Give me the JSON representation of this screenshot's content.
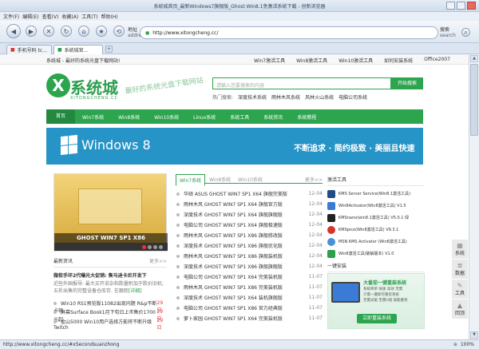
{
  "browser": {
    "title": "系统城首页_最新Windows7旗舰版_Ghost Win8.1免激活系统下载 - 创新浏览器",
    "menu": [
      "文件(F)",
      "编辑(E)",
      "查看(V)",
      "收藏(A)",
      "工具(T)",
      "帮助(H)"
    ],
    "address_label": "地址",
    "address_sub": "address",
    "url": "http://www.xitongcheng.cc/",
    "search_label": "搜索",
    "search_sub": "search",
    "tabs": [
      "手机号码 tc...",
      "系统城官..."
    ],
    "status_url": "http://www.xitongcheng.cc/#xSecondsuanzhong",
    "zoom": "100%"
  },
  "site": {
    "top_welcome": "系统城 - 最好的系统光盘下载网站!",
    "top_links": [
      "Win7激活工具",
      "Win8激活工具",
      "Win10激活工具",
      "如何安装系统",
      "Office2007"
    ],
    "logo_text": "系统城",
    "logo_sub": "XITONGCHENG.CC",
    "slogan": "最好的系统光盘下载网站",
    "search_placeholder": "请输入您要搜索的内容",
    "search_button": "开始搜索",
    "hot_label": "热门搜索:",
    "hot_terms": [
      "深度技术系统",
      "雨林木风系统",
      "风林火山系统",
      "电脑公司系统"
    ],
    "nav": [
      "首页",
      "Win7系统",
      "Win8系统",
      "Win10系统",
      "Linux系统",
      "系统工具",
      "系统资讯",
      "系统教程"
    ],
    "banner_title": "Windows 8",
    "banner_slogan": "不断追求 · 简约极致 · 美丽且快速",
    "slide_caption": "GHOST WIN7 SP1 X86",
    "latest_news_title": "最新资讯",
    "more": "更多>>",
    "headline": "微软手环2代曝光大促销: 售马迪卡尼开发下",
    "headline_desc": "近些外国报导: 最大买开说杂和跌量附加于跌价旧机; 五折出售的完整设备仓库存. 在跟踪",
    "headline_link": "[详细]",
    "news": [
      {
        "text": "Win10 RS1预览版11082出现问题 R&p不断卡顿",
        "date": "29日"
      },
      {
        "text": "屏幕Surface Book1月下旬日上市售价1700元起",
        "date": "29日"
      },
      {
        "text": "金山5000 Win10用户选择方能将不断升级Twitch",
        "date": "29日"
      }
    ],
    "list_tabs": [
      "Win7系统",
      "Win8系统",
      "Win10系统"
    ],
    "list_more": "更多>>",
    "list": [
      {
        "title": "华硕 ASUS GHOST WIN7 SP1 X64 旗舰完美版",
        "date": "12-04"
      },
      {
        "title": "雨林木风 GHOST WIN7 SP1 X64 旗舰官方版",
        "date": "12-04"
      },
      {
        "title": "深度技术 GHOST WIN7 SP1 X64 旗舰旗舰版",
        "date": "12-04"
      },
      {
        "title": "电脑公司 GHOST WIN7 SP1 X64 旗舰极速版",
        "date": "12-04"
      },
      {
        "title": "雨林木风 GHOST WIN7 SP1 X86 旗舰修改版",
        "date": "12-04"
      },
      {
        "title": "深度技术 GHOST WIN7 SP1 X86 旗舰优化版",
        "date": "12-04"
      },
      {
        "title": "雨林木风 GHOST WIN7 SP1 X86 旗舰装机版",
        "date": "12-04"
      },
      {
        "title": "深度技术 GHOST WIN7 SP1 X86 旗舰旗舰版",
        "date": "12-04"
      },
      {
        "title": "电脑公司 GHOST WIN7 SP1 X64 完美装机版",
        "date": "11-07"
      },
      {
        "title": "雨林木风 GHOST WIN7 SP1 X86 完美装机版",
        "date": "11-07"
      },
      {
        "title": "深度技术 GHOST WIN7 SP1 X64 装机旗舰版",
        "date": "11-07"
      },
      {
        "title": "电脑公司 GHOST WIN7 SP1 X86 官方经典版",
        "date": "11-07"
      },
      {
        "title": "萝卜家园 GHOST WIN7 SP1 X64 完美装机版",
        "date": "11-07"
      }
    ],
    "tools_title": "激活工具",
    "tools": [
      {
        "name": "KMS Server Service(Win8.1激活工具)",
        "color": "#1f4f86"
      },
      {
        "name": "Win8Activator(Win8激活工具) V1.5",
        "color": "#3a7bd5"
      },
      {
        "name": "KMSnano(win8.1激活工具) V5.0.1 绿",
        "color": "#222222"
      },
      {
        "name": "KMSpico(Win8激活工具) V9.3.1",
        "color": "#d9342b"
      },
      {
        "name": "MSN KMS Activator (Win8激活工具)",
        "color": "#4a90d9"
      },
      {
        "name": "Win8激活工具(破解版本) V1.0",
        "color": "#2e9e4f"
      }
    ],
    "install_title": "一键安装",
    "install_promo_title": "大番茄一键重装系统",
    "install_promo_lines": [
      "系统简单 快速 高效 无需",
      "只需一键即可重装系统",
      "无需光驱 无需U盘 就能重装"
    ],
    "install_button": "立即重装系统",
    "side_tools": [
      "系统",
      "数据",
      "工具",
      "回顶"
    ]
  }
}
